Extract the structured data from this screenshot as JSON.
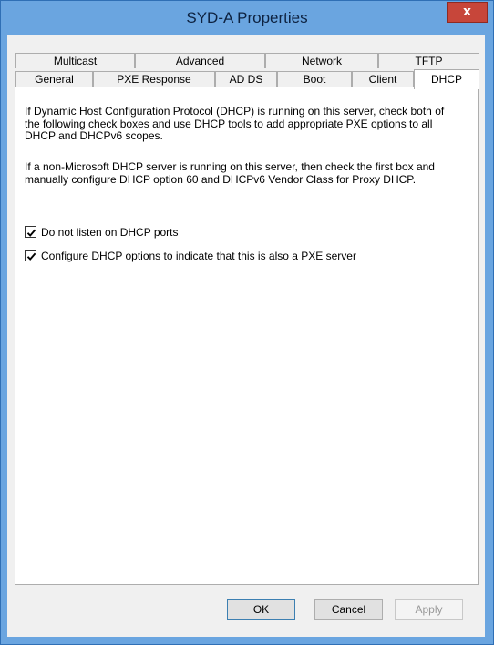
{
  "window": {
    "title": "SYD-A Properties",
    "close_glyph": "x"
  },
  "tabs_row1": [
    "Multicast",
    "Advanced",
    "Network",
    "TFTP"
  ],
  "tabs_row2": [
    "General",
    "PXE Response",
    "AD DS",
    "Boot",
    "Client",
    "DHCP"
  ],
  "active_tab": "DHCP",
  "panel": {
    "para1": "If Dynamic Host Configuration Protocol (DHCP) is running on this server, check both of the following check boxes and use DHCP tools to add appropriate PXE options to all DHCP and DHCPv6 scopes.",
    "para2": "If a non-Microsoft DHCP server is running on this server, then check the first box and manually configure DHCP option 60 and DHCPv6 Vendor Class for Proxy DHCP.",
    "checkbox1": {
      "label": "Do not listen on DHCP ports",
      "checked": true
    },
    "checkbox2": {
      "label": "Configure DHCP options to indicate that this is also a PXE server",
      "checked": true
    }
  },
  "buttons": {
    "ok": "OK",
    "cancel": "Cancel",
    "apply": "Apply"
  },
  "colors": {
    "frame": "#6aa5e0",
    "close": "#c7463a",
    "panel": "#ffffff"
  }
}
